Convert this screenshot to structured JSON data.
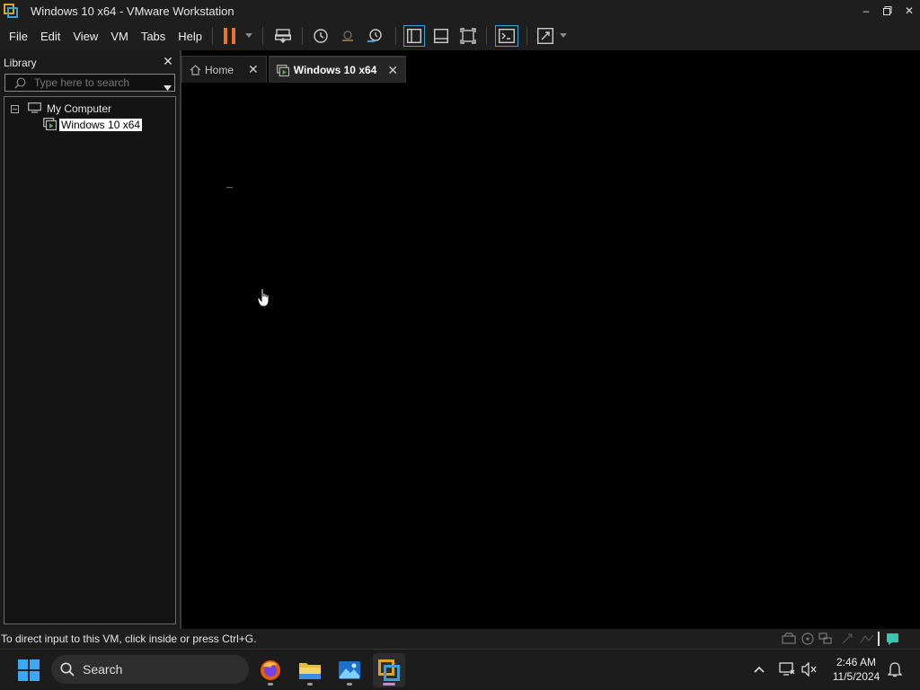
{
  "window": {
    "title": "Windows 10 x64 - VMware Workstation"
  },
  "menu": [
    "File",
    "Edit",
    "View",
    "VM",
    "Tabs",
    "Help"
  ],
  "library": {
    "title": "Library",
    "search_placeholder": "Type here to search",
    "tree": {
      "root": "My Computer",
      "vm": "Windows 10 x64"
    }
  },
  "tabs": [
    {
      "label": "Home",
      "active": false
    },
    {
      "label": "Windows 10 x64",
      "active": true
    }
  ],
  "vm_screen": {
    "cursor_text": "_"
  },
  "status": {
    "message": "To direct input to this VM, click inside or press Ctrl+G."
  },
  "taskbar": {
    "search_label": "Search",
    "time": "2:46 AM",
    "date": "11/5/2024"
  },
  "colors": {
    "pause_accent": "#e8742a",
    "vmware_orange": "#e6a21e",
    "vmware_blue": "#3aa0d8"
  }
}
